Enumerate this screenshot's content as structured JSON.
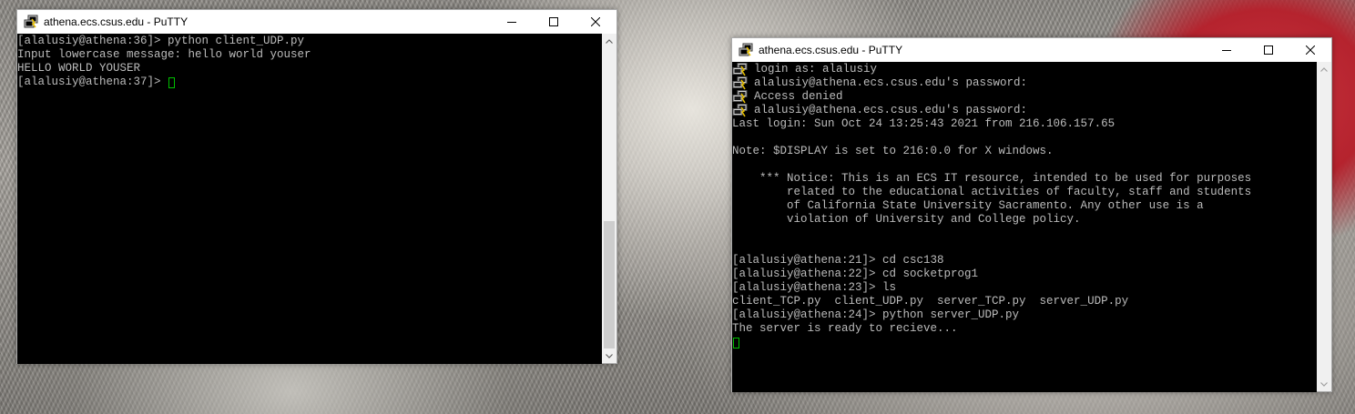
{
  "windows": [
    {
      "title": "athena.ecs.csus.edu - PuTTY",
      "lines": [
        {
          "text": "[alalusiy@athena:36]> python client_UDP.py",
          "icon": false
        },
        {
          "text": "Input lowercase message: hello world youser",
          "icon": false
        },
        {
          "text": "HELLO WORLD YOUSER",
          "icon": false
        },
        {
          "text": "[alalusiy@athena:37]> ",
          "icon": false,
          "cursor": true
        }
      ]
    },
    {
      "title": "athena.ecs.csus.edu - PuTTY",
      "lines": [
        {
          "text": "login as: alalusiy",
          "icon": true
        },
        {
          "text": "alalusiy@athena.ecs.csus.edu's password:",
          "icon": true
        },
        {
          "text": "Access denied",
          "icon": true
        },
        {
          "text": "alalusiy@athena.ecs.csus.edu's password:",
          "icon": true
        },
        {
          "text": "Last login: Sun Oct 24 13:25:43 2021 from 216.106.157.65",
          "icon": false
        },
        {
          "text": "",
          "icon": false
        },
        {
          "text": "Note: $DISPLAY is set to 216:0.0 for X windows.",
          "icon": false
        },
        {
          "text": "",
          "icon": false
        },
        {
          "text": "    *** Notice: This is an ECS IT resource, intended to be used for purposes",
          "icon": false
        },
        {
          "text": "        related to the educational activities of faculty, staff and students",
          "icon": false
        },
        {
          "text": "        of California State University Sacramento. Any other use is a",
          "icon": false
        },
        {
          "text": "        violation of University and College policy.",
          "icon": false
        },
        {
          "text": "",
          "icon": false
        },
        {
          "text": "",
          "icon": false
        },
        {
          "text": "[alalusiy@athena:21]> cd csc138",
          "icon": false
        },
        {
          "text": "[alalusiy@athena:22]> cd socketprog1",
          "icon": false
        },
        {
          "text": "[alalusiy@athena:23]> ls",
          "icon": false
        },
        {
          "text": "client_TCP.py  client_UDP.py  server_TCP.py  server_UDP.py",
          "icon": false
        },
        {
          "text": "[alalusiy@athena:24]> python server_UDP.py",
          "icon": false
        },
        {
          "text": "The server is ready to recieve...",
          "icon": false
        },
        {
          "text": "",
          "icon": false,
          "cursor": true
        }
      ]
    }
  ]
}
